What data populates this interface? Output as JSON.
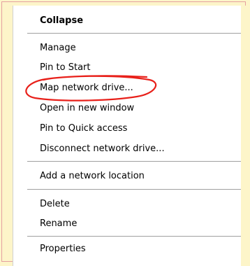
{
  "menu": {
    "items": [
      {
        "label": "Collapse"
      },
      {
        "label": "Manage"
      },
      {
        "label": "Pin to Start"
      },
      {
        "label": "Map network drive..."
      },
      {
        "label": "Open in new window"
      },
      {
        "label": "Pin to Quick access"
      },
      {
        "label": "Disconnect network drive..."
      },
      {
        "label": "Add a network location"
      },
      {
        "label": "Delete"
      },
      {
        "label": "Rename"
      },
      {
        "label": "Properties"
      }
    ]
  },
  "colors": {
    "background": "#fdf5c9",
    "menu_background": "#ffffff",
    "separator": "#a0a0a0",
    "annotation": "#e8201a"
  }
}
